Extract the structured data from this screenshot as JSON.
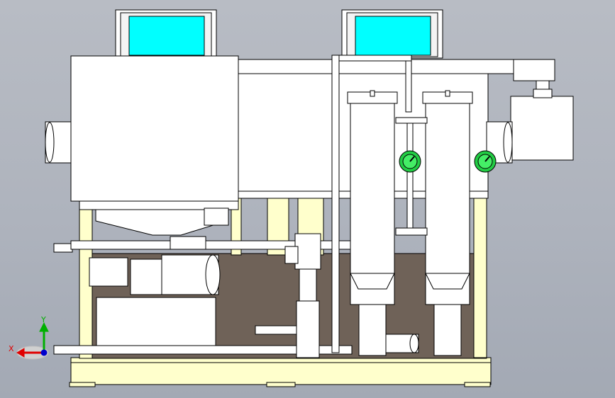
{
  "viewport": {
    "background_top": "#b8bcc4",
    "background_bottom": "#a3a9b4"
  },
  "colors": {
    "line": "#000000",
    "metal": "#ffffff",
    "frame_yellow": "#ffffcc",
    "screen_cyan": "#00ffff",
    "gauge_green": "#22cc44",
    "cavity_brown": "#6f6258",
    "axis_x": "#e00000",
    "axis_y": "#00b000",
    "axis_z": "#0000cc"
  },
  "triad": {
    "x_label": "X",
    "y_label": "Y"
  },
  "icons": [
    "axis-triad-icon",
    "pressure-gauge-icon",
    "display-screen-icon"
  ]
}
